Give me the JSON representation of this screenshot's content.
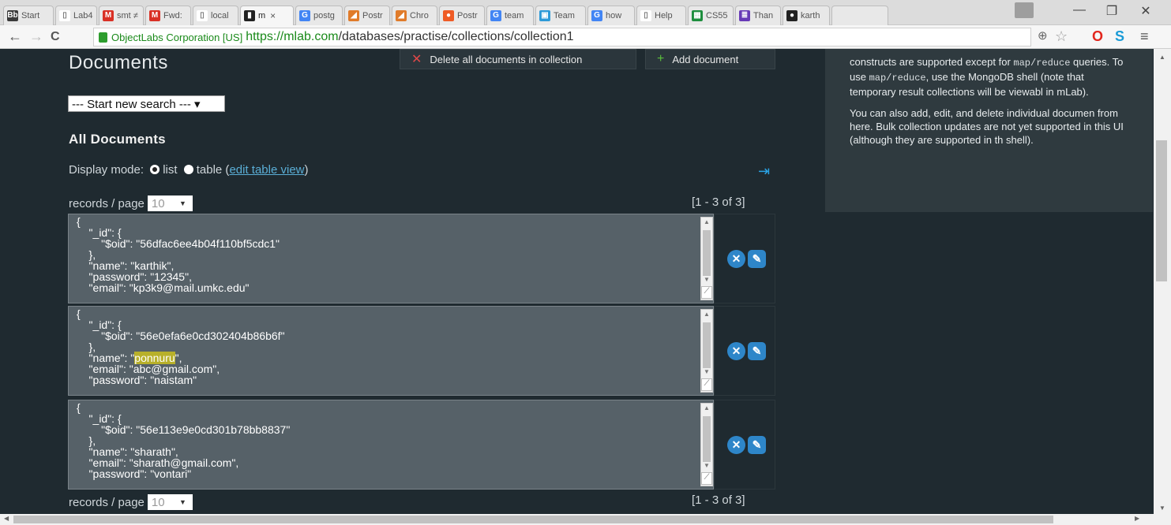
{
  "browser": {
    "tabs": [
      {
        "label": "Start",
        "icon": "blackboard-icon",
        "color": "#3a3a3a",
        "glyph": "Bb"
      },
      {
        "label": "Lab4",
        "icon": "page-icon",
        "color": "#ffffff",
        "glyph": "▯"
      },
      {
        "label": "smt ≠",
        "icon": "gmail-icon",
        "color": "#d93025",
        "glyph": "M"
      },
      {
        "label": "Fwd:",
        "icon": "gmail-icon",
        "color": "#d93025",
        "glyph": "M"
      },
      {
        "label": "local",
        "icon": "page-icon",
        "color": "#ffffff",
        "glyph": "▯"
      },
      {
        "label": "m",
        "icon": "mlab-icon",
        "color": "#222222",
        "glyph": "▮",
        "active": true
      },
      {
        "label": "postg",
        "icon": "google-icon",
        "color": "#4285f4",
        "glyph": "G"
      },
      {
        "label": "Postr",
        "icon": "postman-icon",
        "color": "#e07b2a",
        "glyph": "◢"
      },
      {
        "label": "Chro",
        "icon": "postman-icon",
        "color": "#e07b2a",
        "glyph": "◢"
      },
      {
        "label": "Postr",
        "icon": "postman-icon",
        "color": "#ef5b25",
        "glyph": "●"
      },
      {
        "label": "team",
        "icon": "google-icon",
        "color": "#4285f4",
        "glyph": "G"
      },
      {
        "label": "Team",
        "icon": "teams-icon",
        "color": "#2d9ad8",
        "glyph": "▣"
      },
      {
        "label": "how",
        "icon": "google-icon",
        "color": "#4285f4",
        "glyph": "G"
      },
      {
        "label": "Help",
        "icon": "page-icon",
        "color": "#ffffff",
        "glyph": "▯"
      },
      {
        "label": "CS55",
        "icon": "sheets-icon",
        "color": "#1e8e3e",
        "glyph": "▦"
      },
      {
        "label": "Than",
        "icon": "forms-icon",
        "color": "#673ab7",
        "glyph": "≣"
      },
      {
        "label": "karth",
        "icon": "github-icon",
        "color": "#222222",
        "glyph": "●"
      },
      {
        "label": "",
        "icon": "page-icon",
        "color": "#e8e8e8",
        "glyph": ""
      }
    ],
    "active_tab_close": "×",
    "window_controls": {
      "minimize": "—",
      "restore": "❐",
      "close": "✕"
    },
    "url_company": "ObjectLabs Corporation [US]",
    "url_host": "https://mlab.com",
    "url_path": "/databases/practise/collections/collection1"
  },
  "page": {
    "title": "Documents",
    "delete_all_label": "Delete all documents in collection",
    "add_document_label": "Add document",
    "search_select": "--- Start new search --- ▾",
    "all_documents": "All Documents",
    "display_mode_label": "Display mode:",
    "mode_list": "list",
    "mode_table": "table",
    "edit_table_view": "edit table view",
    "records_per_page_label": "records / page",
    "records_per_page_value": "10",
    "pager": "[1 - 3 of 3]",
    "records": [
      {
        "id": "56dfac6ee4b04f110bf5cdc1",
        "fields": [
          [
            "name",
            "karthik"
          ],
          [
            "password",
            "12345"
          ],
          [
            "email",
            "kp3k9@mail.umkc.edu"
          ]
        ]
      },
      {
        "id": "56e0efa6e0cd302404b86b6f",
        "fields": [
          [
            "name",
            "ponnuru"
          ],
          [
            "email",
            "abc@gmail.com"
          ],
          [
            "password",
            "naistam"
          ]
        ],
        "highlight": "ponnuru"
      },
      {
        "id": "56e113e9e0cd301b78bb8837",
        "fields": [
          [
            "name",
            "sharath"
          ],
          [
            "email",
            "sharath@gmail.com"
          ],
          [
            "password",
            "vontari"
          ]
        ]
      }
    ]
  },
  "sidebar": {
    "p1_pre": "constructs are supported except for ",
    "p1_code1": "map/reduce",
    "p1_mid": " queries. To use ",
    "p1_code2": "map/reduce",
    "p1_post": ", use the MongoDB shell (note that temporary result collections will be viewabl in mLab).",
    "p2": "You can also add, edit, and delete individual documen from here. Bulk collection updates are not yet supported in this UI (although they are supported in th shell)."
  }
}
